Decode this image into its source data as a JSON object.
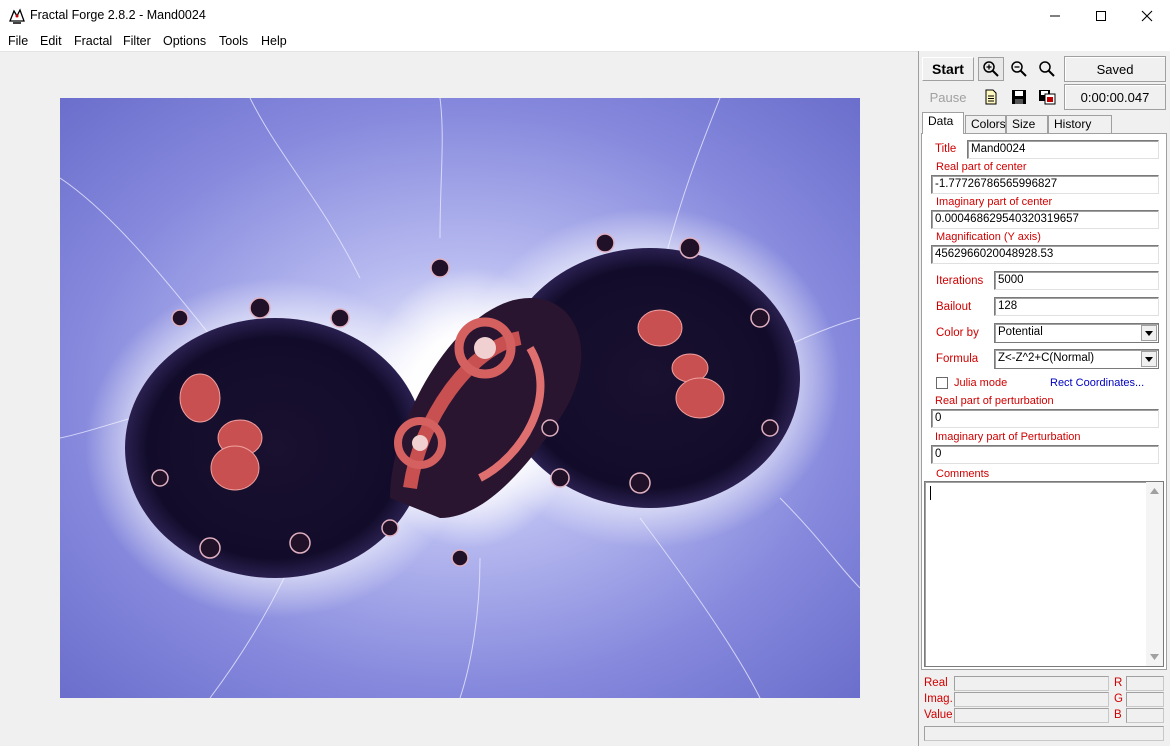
{
  "window": {
    "title": "Fractal Forge 2.8.2 - Mand0024",
    "icons": [
      "app-icon",
      "minimize-icon",
      "maximize-icon",
      "close-icon"
    ]
  },
  "menu": [
    "File",
    "Edit",
    "Fractal",
    "Filter",
    "Options",
    "Tools",
    "Help"
  ],
  "toolbar": {
    "start_label": "Start",
    "pause_label": "Pause",
    "saved_label": "Saved",
    "timer": "0:00:00.047",
    "icons": [
      "zoom-in-icon",
      "zoom-out-icon",
      "zoom-reset-icon",
      "new-document-icon",
      "save-icon",
      "save-as-icon"
    ]
  },
  "tabs": [
    "Data",
    "Colors",
    "Size",
    "History List"
  ],
  "active_tab": "Data",
  "data": {
    "title_label": "Title",
    "title_value": "Mand0024",
    "real_center_label": "Real part of center",
    "real_center_value": "-1.77726786565996827",
    "imag_center_label": "Imaginary part of center",
    "imag_center_value": "0.000468629540320319657",
    "magnification_label": "Magnification (Y axis)",
    "magnification_value": "4562966020048928.53",
    "iterations_label": "Iterations",
    "iterations_value": "5000",
    "bailout_label": "Bailout",
    "bailout_value": "128",
    "colorby_label": "Color by",
    "colorby_value": "Potential",
    "formula_label": "Formula",
    "formula_value": "Z<-Z^2+C(Normal)",
    "julia_label": "Julia mode",
    "julia_checked": false,
    "rect_link": "Rect Coordinates...",
    "real_perturb_label": "Real part of perturbation",
    "real_perturb_value": "0",
    "imag_perturb_label": "Imaginary part of Perturbation",
    "imag_perturb_value": "0",
    "comments_label": "Comments",
    "comments_value": ""
  },
  "readout": {
    "real_label": "Real",
    "imag_label": "Imag.",
    "value_label": "Value",
    "r_label": "R",
    "g_label": "G",
    "b_label": "B"
  },
  "colors": {
    "label_red": "#d00000",
    "link_blue": "#0000c0",
    "fractal_background": "#7d80d8",
    "fractal_interior": "#0a0a2a",
    "fractal_accent": "#c85050"
  }
}
